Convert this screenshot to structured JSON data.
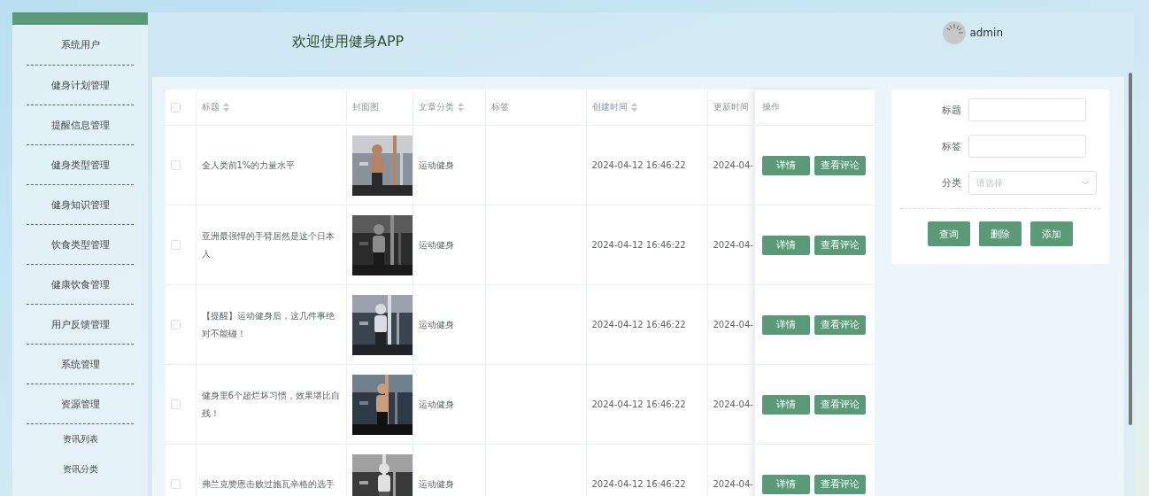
{
  "sidebar": {
    "items": [
      {
        "label": "系统用户",
        "kind": "group"
      },
      {
        "label": "健身计划管理",
        "kind": "group"
      },
      {
        "label": "提醒信息管理",
        "kind": "group"
      },
      {
        "label": "健身类型管理",
        "kind": "group"
      },
      {
        "label": "健身知识管理",
        "kind": "group"
      },
      {
        "label": "饮食类型管理",
        "kind": "group"
      },
      {
        "label": "健康饮食管理",
        "kind": "group"
      },
      {
        "label": "用户反馈管理",
        "kind": "group"
      },
      {
        "label": "系统管理",
        "kind": "group"
      },
      {
        "label": "资源管理",
        "kind": "group"
      },
      {
        "label": "资讯列表",
        "kind": "sub"
      },
      {
        "label": "资讯分类",
        "kind": "sub"
      }
    ]
  },
  "header": {
    "title": "欢迎使用健身APP",
    "user": "admin"
  },
  "table": {
    "select_all": {
      "checked": false
    },
    "columns": [
      {
        "label": "标题",
        "sortable": true
      },
      {
        "label": "封面图",
        "sortable": false
      },
      {
        "label": "文章分类",
        "sortable": true
      },
      {
        "label": "标签",
        "sortable": false
      },
      {
        "label": "创建时间",
        "sortable": true
      },
      {
        "label": "更新时间"
      },
      {
        "label": "操作",
        "sortable": false
      }
    ],
    "rows": [
      {
        "checked": false,
        "title": "全人类前1%的力量水平",
        "cover": {
          "kind": "picture"
        },
        "category": "运动健身",
        "created": "2024-04-12 16:46:22",
        "updated": "2024-04-",
        "actions": [
          "详情",
          "查看评论"
        ]
      },
      {
        "checked": false,
        "title": "亚洲最强悍的手臂居然是这个日本人",
        "cover": {
          "kind": "picture"
        },
        "category": "运动健身",
        "created": "2024-04-12 16:46:22",
        "updated": "2024-04-",
        "actions": [
          "详情",
          "查看评论"
        ]
      },
      {
        "checked": false,
        "title": "【提醒】运动健身后，这几件事绝对不能碰！",
        "cover": {
          "kind": "picture"
        },
        "category": "运动健身",
        "created": "2024-04-12 16:46:22",
        "updated": "2024-04-",
        "actions": [
          "详情",
          "查看评论"
        ]
      },
      {
        "checked": false,
        "title": "健身里6个超烂坏习惯，效果堪比自残！",
        "cover": {
          "kind": "picture"
        },
        "category": "运动健身",
        "created": "2024-04-12 16:46:22",
        "updated": "2024-04-",
        "actions": [
          "详情",
          "查看评论"
        ]
      },
      {
        "checked": false,
        "title": "弗兰克赞恩击败过施瓦辛格的选手",
        "cover": {
          "kind": "picture"
        },
        "category": "运动健身",
        "created": "2024-04-12 16:46:22",
        "updated": "2024-04-",
        "actions": [
          "详情",
          "查看评论"
        ]
      }
    ]
  },
  "search_form": {
    "fields": [
      {
        "label": "标题",
        "kind": "input"
      },
      {
        "label": "标签",
        "kind": "input"
      },
      {
        "label": "分类",
        "kind": "select",
        "placeholder": "请选择"
      }
    ],
    "buttons": [
      "查询",
      "删除",
      "添加"
    ]
  }
}
